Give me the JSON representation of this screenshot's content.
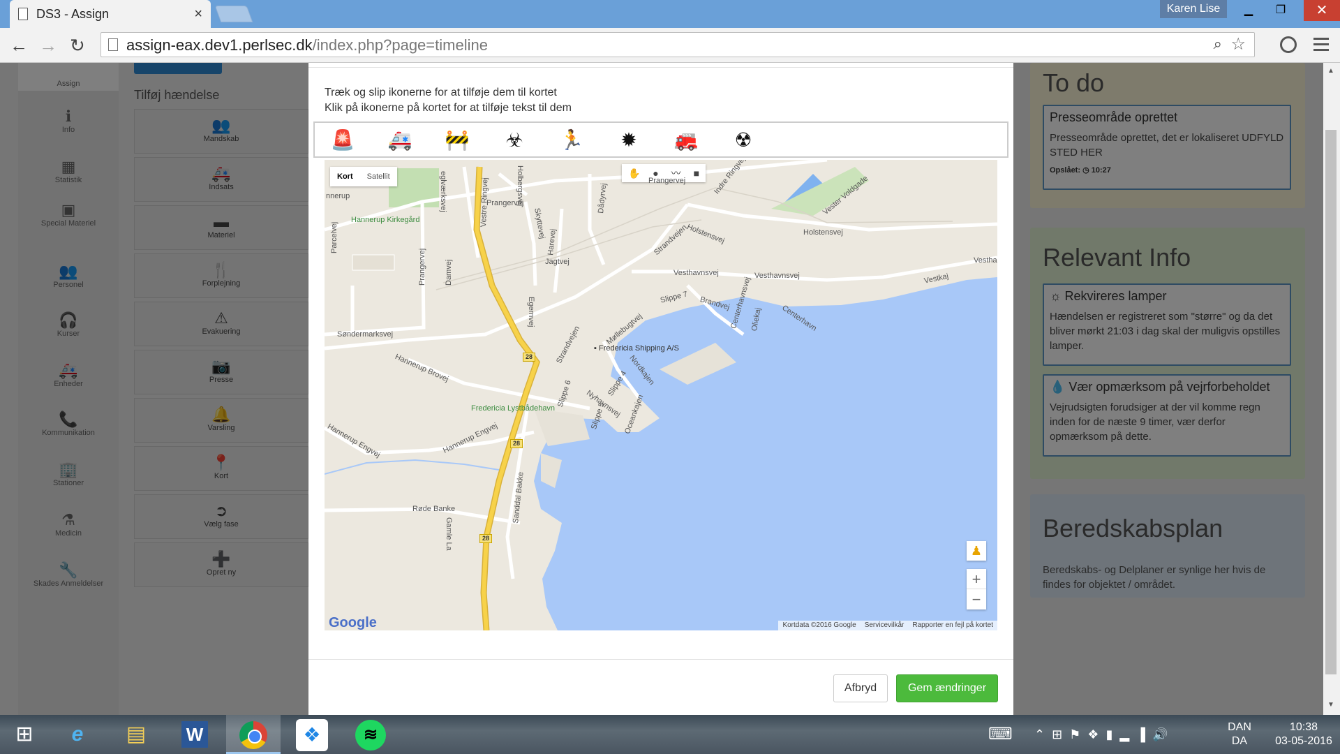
{
  "browser": {
    "tab_title": "DS3 - Assign",
    "tab_close": "×",
    "user": "Karen Lise",
    "url_host": "assign-eax.dev1.perlsec.dk",
    "url_path": "/index.php?page=timeline"
  },
  "sidebar": {
    "items": [
      {
        "label": "Assign",
        "icon": "assign-icon",
        "glyph": ""
      },
      {
        "label": "Info",
        "icon": "info-icon",
        "glyph": "ℹ"
      },
      {
        "label": "Statistik",
        "icon": "calendar-icon",
        "glyph": "▦"
      },
      {
        "label": "Special Materiel",
        "icon": "briefcase-icon",
        "glyph": "▣"
      },
      {
        "label": "Personel",
        "icon": "users-icon",
        "glyph": "👥"
      },
      {
        "label": "Kurser",
        "icon": "headset-icon",
        "glyph": "🎧"
      },
      {
        "label": "Enheder",
        "icon": "ambulance-icon",
        "glyph": "🚑"
      },
      {
        "label": "Kommunikation",
        "icon": "phone-icon",
        "glyph": "📞"
      },
      {
        "label": "Stationer",
        "icon": "building-icon",
        "glyph": "🏢"
      },
      {
        "label": "Medicin",
        "icon": "flask-icon",
        "glyph": "⚗"
      },
      {
        "label": "Skades Anmeldelser",
        "icon": "wrench-icon",
        "glyph": "🔧"
      }
    ]
  },
  "events": {
    "title": "Tilføj hændelse",
    "items": [
      {
        "label": "Mandskab",
        "icon": "group-icon",
        "glyph": "👥"
      },
      {
        "label": "Indsats",
        "icon": "ambulance-icon",
        "glyph": "🚑"
      },
      {
        "label": "Materiel",
        "icon": "box-icon",
        "glyph": "▬"
      },
      {
        "label": "Forplejning",
        "icon": "cutlery-icon",
        "glyph": "🍴"
      },
      {
        "label": "Evakuering",
        "icon": "warning-icon",
        "glyph": "⚠"
      },
      {
        "label": "Presse",
        "icon": "camera-icon",
        "glyph": "📷"
      },
      {
        "label": "Varsling",
        "icon": "bell-icon",
        "glyph": "🔔"
      },
      {
        "label": "Kort",
        "icon": "map-marker-icon",
        "glyph": "📍"
      },
      {
        "label": "Vælg fase",
        "icon": "arrow-circle-icon",
        "glyph": "➲"
      },
      {
        "label": "Opret ny",
        "icon": "plus-square-icon",
        "glyph": "➕"
      }
    ]
  },
  "right": {
    "todo": {
      "title": "To do",
      "card_head": "Presseområde oprettet",
      "card_body": "Presseområde oprettet, det er lokaliseret UDFYLD STED HER",
      "card_meta": "Opslået: ◷ 10:27"
    },
    "info": {
      "title": "Relevant Info",
      "card1_head": "☼ Rekvireres lamper",
      "card1_body": "Hændelsen er registreret som \"større\" og da det bliver mørkt 21:03 i dag skal der mulig­vis opstilles lamper.",
      "card2_head": "💧 Vær opmærksom på vejrforbeholdet",
      "card2_body": "Vejrudsigten forudsiger at der vil komme regn inden for de næste 9 timer, vær derfor opmærksom på dette."
    },
    "plan": {
      "title": "Beredskabsplan",
      "text": "Beredskabs- og Delplaner er synlige her hvis de findes for objektet / området."
    }
  },
  "modal": {
    "instruction_1": "Træk og slip ikonerne for at tilføje dem til kortet",
    "instruction_2": "Klik på ikonerne på kortet for at tilføje tekst til dem",
    "drag_icons": [
      {
        "name": "siren-icon",
        "glyph": "🚨"
      },
      {
        "name": "ambulance-icon",
        "glyph": "🚑"
      },
      {
        "name": "roadblock-icon",
        "glyph": "🚧"
      },
      {
        "name": "biohazard-icon",
        "glyph": "☣"
      },
      {
        "name": "emergency-exit-icon",
        "glyph": "🏃"
      },
      {
        "name": "virus-icon",
        "glyph": "✹"
      },
      {
        "name": "fire-truck-icon",
        "glyph": "🚒"
      },
      {
        "name": "radiation-icon",
        "glyph": "☢"
      }
    ],
    "cancel_label": "Afbryd",
    "save_label": "Gem ændringer"
  },
  "map": {
    "type_map": "Kort",
    "type_satellite": "Satellit",
    "zoom_in": "+",
    "zoom_out": "−",
    "google": "Google",
    "footer_data": "Kortdata ©2016 Google",
    "footer_terms": "Servicevilkår",
    "footer_report": "Rapporter en fejl på kortet",
    "labels": {
      "prangervej_top": "Prangervej",
      "prangervej_mid": "Prangervej",
      "prangervej_v": "Prangervej",
      "vestre_ringvej": "Vestre Ringvej",
      "hannerup_kirkegaard": "Hannerup Kirkegård",
      "parcelvej": "Parcelvej",
      "damvej": "Damvej",
      "holbergsvej": "Holbergsvej",
      "skyttevej": "Skyttevej",
      "harevej": "Harevej",
      "jagtvej": "Jagtvej",
      "egernvej": "Egernvej",
      "daadyrvej": "Dådyrvej",
      "indre_ringvej": "Indre Ringvej",
      "vester_voldgade": "Vester Voldgade",
      "holstensvej_1": "Holstensvej",
      "holstensvej_2": "Holstensvej",
      "strandvejen_1": "Strandvejen",
      "strandvejen_2": "Strandvejen",
      "vesthavnsvej_1": "Vesthavnsvej",
      "vesthavnsvej_2": "Vesthavnsvej",
      "vestha": "Vestha",
      "vestkaj": "Vestkaj",
      "slippe7": "Slippe 7",
      "brandvej": "Brandvej",
      "centerhavnsvej": "Centerhavnsvej",
      "oliekaj": "Oliekaj",
      "centerhavn": "Centerhavn",
      "sondermarksvej": "Søndermarksvej",
      "mollebugtvej": "Møllebugtvej",
      "fredericia_shipping": "Fredericia Shipping A/S",
      "nordkajen": "Nordkajen",
      "hannerup_brovej": "Hannerup Brovej",
      "slippe6": "Slippe 6",
      "slippe4": "Slippe 4",
      "nyhavnsvej": "Nyhavnsvej",
      "slippe5": "Slippe 5",
      "oceankajen": "Oceankajen",
      "lystbaadehavn": "Fredericia Lystbådehavn",
      "hannerup_engvej_1": "Hannerup Engvej",
      "hannerup_engvej_2": "Hannerup Engvej",
      "sanddal_bakke": "Sanddal Bakke",
      "rode_banke": "Røde Banke",
      "gamle": "Gamle La",
      "innerup": "nnerup",
      "eglvaerksvej": "eglværksvej",
      "route": "28"
    }
  },
  "taskbar": {
    "lang_1": "DAN",
    "lang_2": "DA",
    "time": "10:38",
    "date": "03-05-2016"
  },
  "colors": {
    "accent_blue": "#5d97c6",
    "save_green": "#4cba3c",
    "water": "#a8c8f8",
    "road_major": "#f7d24a"
  }
}
